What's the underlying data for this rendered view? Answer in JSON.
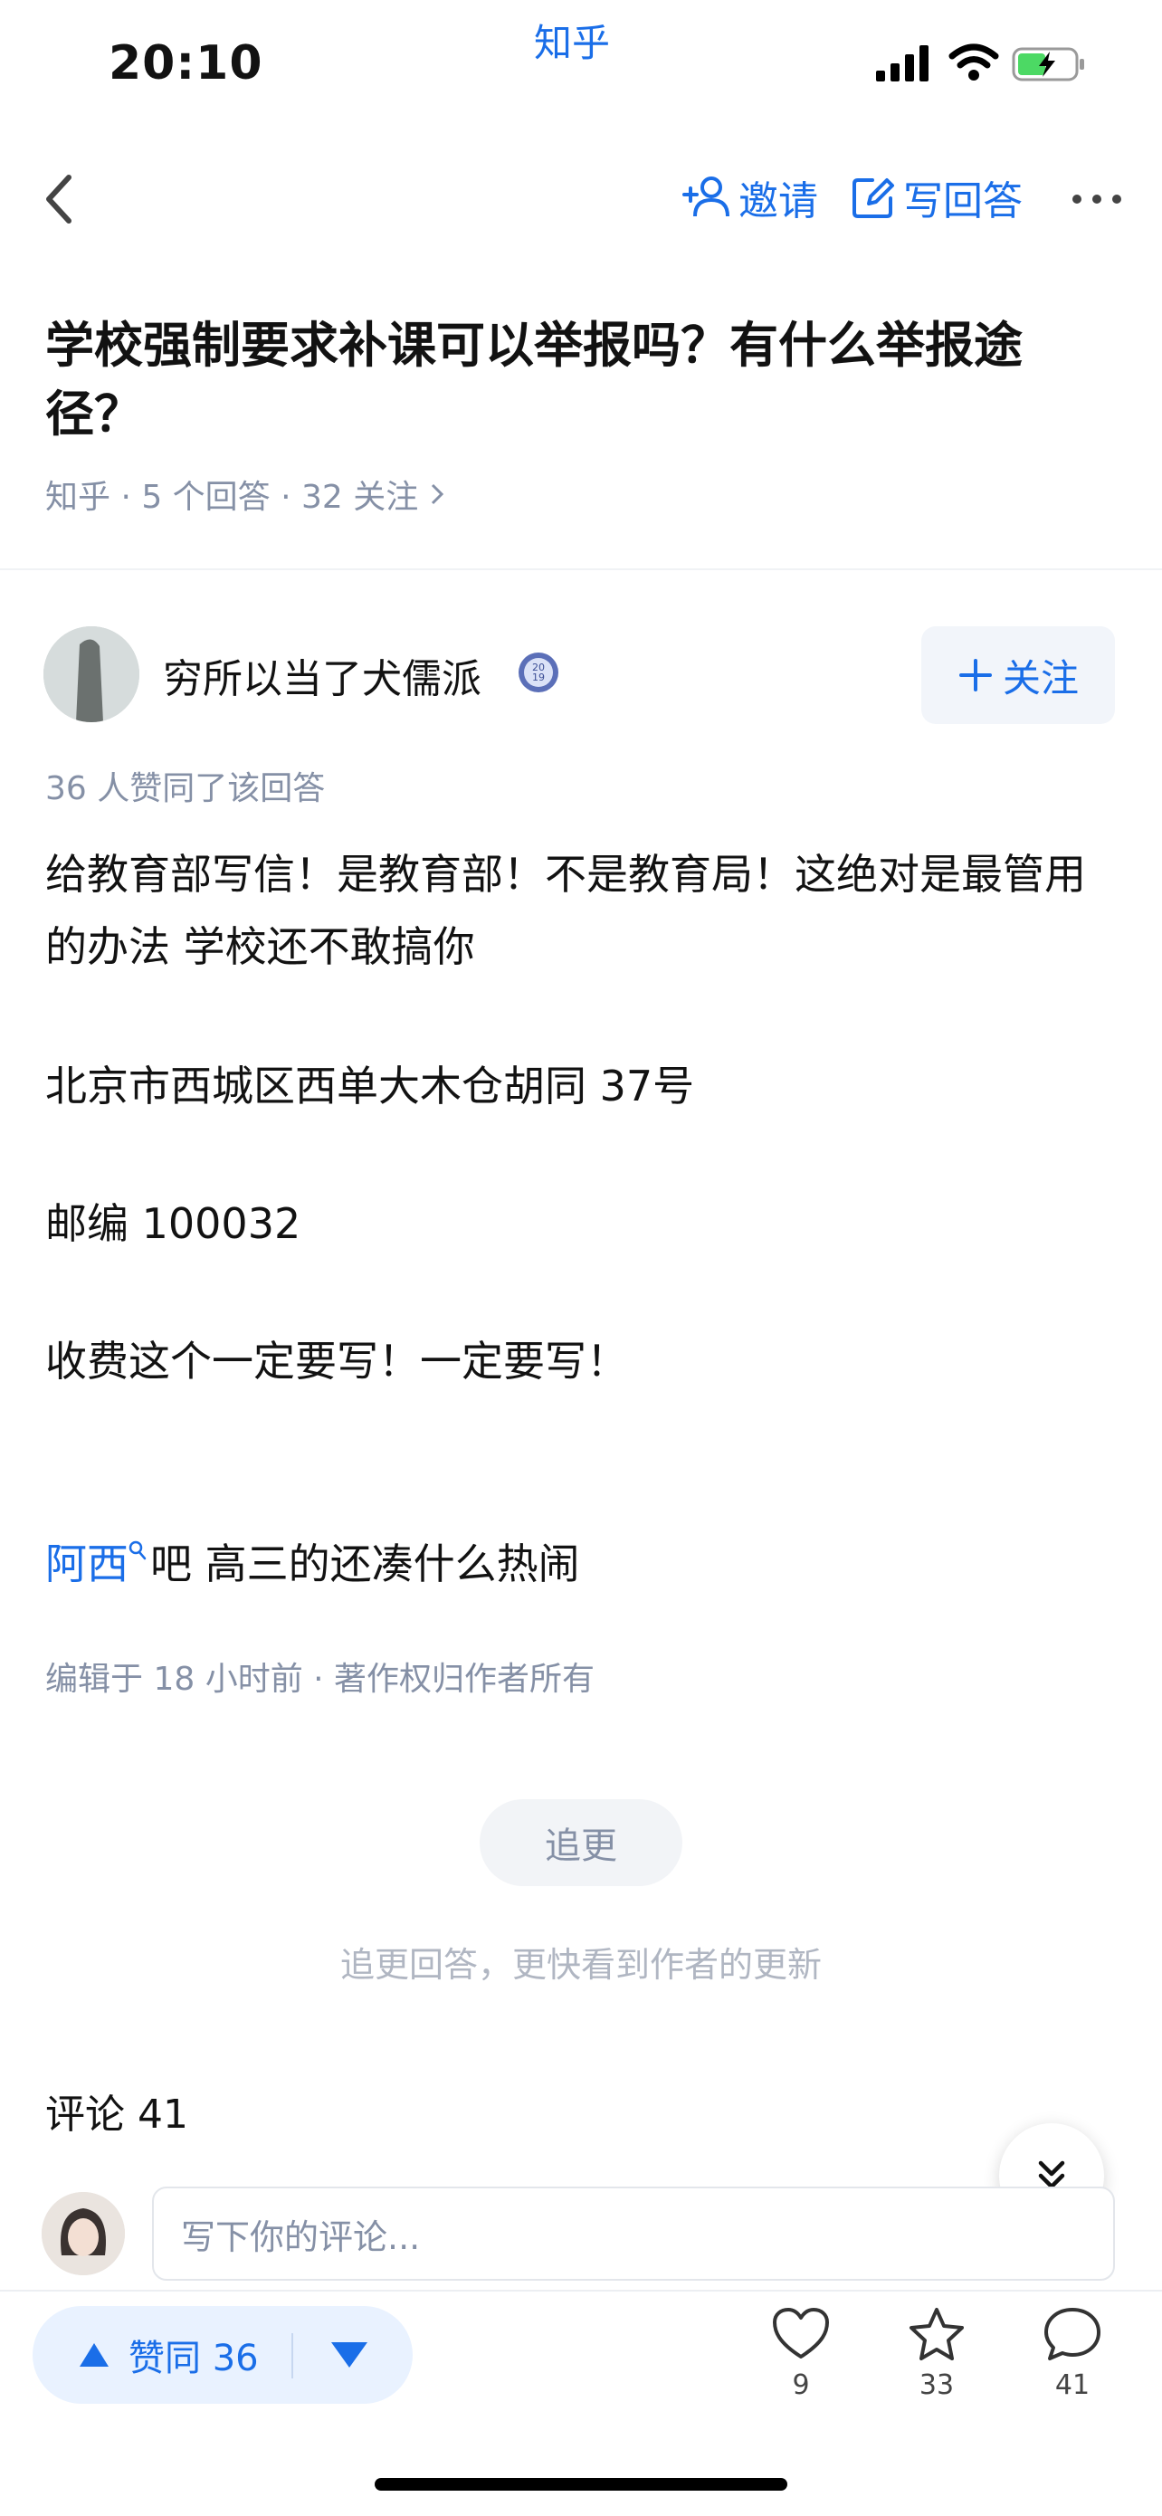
{
  "status_bar": {
    "time": "20:10",
    "app_name": "知乎"
  },
  "nav": {
    "invite_label": "邀请",
    "write_answer_label": "写回答"
  },
  "question": {
    "title": "学校强制要求补课可以举报吗？有什么举报途径？",
    "meta": "知乎 · 5 个回答 · 32 关注"
  },
  "answer": {
    "author_name": "穷所以当了犬儒派",
    "badge_text": "2019",
    "follow_label": "关注",
    "upvote_note": "36 人赞同了该回答",
    "paragraphs": [
      "给教育部写信！是教育部！不是教育局！这绝对是最管用的办法 学校还不敢搞你",
      "北京市西城区西单大木仓胡同 37号",
      "邮编 100032",
      "收费这个一定要写！一定要写！"
    ],
    "last_line_link": "阿西",
    "last_line_rest": "吧 高三的还凑什么热闹",
    "edit_meta": "编辑于 18 小时前 · 著作权归作者所有",
    "update_button": "追更",
    "update_hint": "追更回答，更快看到作者的更新"
  },
  "comments": {
    "title": "评论 41",
    "input_placeholder": "写下你的评论..."
  },
  "bottom_bar": {
    "vote_label": "赞同 36",
    "like_count": "9",
    "favorite_count": "33",
    "comment_count": "41"
  },
  "colors": {
    "accent": "#1a6ee8",
    "meta_gray": "#8590a6",
    "vote_bg": "#e9f2ff"
  }
}
